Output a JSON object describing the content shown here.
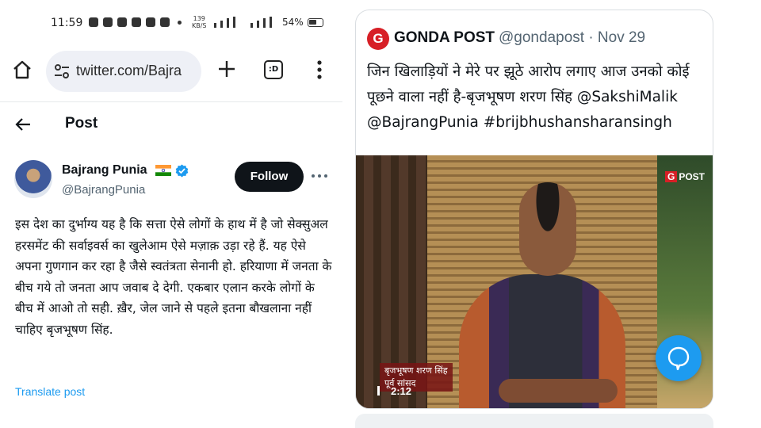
{
  "status_bar": {
    "time": "11:59",
    "net_speed_value": "139",
    "net_speed_unit": "KB/S",
    "battery": "54%"
  },
  "browser": {
    "url": "twitter.com/Bajra",
    "tabs_label": ":D"
  },
  "page": {
    "title": "Post"
  },
  "post": {
    "author_name": "Bajrang Punia",
    "author_handle": "@BajrangPunia",
    "follow_label": "Follow",
    "text": "इस देश का दुर्भाग्य यह है कि सत्ता ऐसे लोगों के हाथ में है जो सेक्सुअल हरसमेंट की सर्वाइवर्स का खुलेआम ऐसे मज़ाक़ उड़ा रहे हैं. यह ऐसे अपना गुणगान कर रहा है जैसे स्वतंत्रता सेनानी हो. हरियाणा में जनता के बीच गये तो जनता आप जवाब दे देगी. एकबार एलान करके लोगों के बीच में आओ तो सही. ख़ैर, जेल जाने से पहले इतना बौखलाना नहीं चाहिए बृजभूषण सिंह.",
    "translate_label": "Translate post"
  },
  "quoted": {
    "logo_letter": "G",
    "name": "GONDA POST",
    "handle_date": "@gondapost · Nov 29",
    "text": "जिन खिलाड़ियों ने मेरे पर झूठे आरोप लगाए आज उनको कोई पूछने वाला नहीं है-बृजभूषण शरण सिंह @SakshiMalik @BajrangPunia #brijbhushansharansingh",
    "video": {
      "watermark_letter": "G",
      "watermark_text": "POST",
      "caption_line1": "बृजभूषण शरण सिंह",
      "caption_line2": "पूर्व सांसद",
      "timestamp": "2:12"
    }
  },
  "colors": {
    "accent": "#1d9bf0",
    "text": "#0f1419",
    "muted": "#536471",
    "brand_red": "#d71f26"
  },
  "icons": [
    "home-icon",
    "tune-icon",
    "plus-icon",
    "tabs-icon",
    "kebab-menu-icon",
    "back-arrow-icon",
    "india-flag-icon",
    "verified-badge-icon",
    "more-icon",
    "play-icon",
    "chat-bubble-icon"
  ]
}
